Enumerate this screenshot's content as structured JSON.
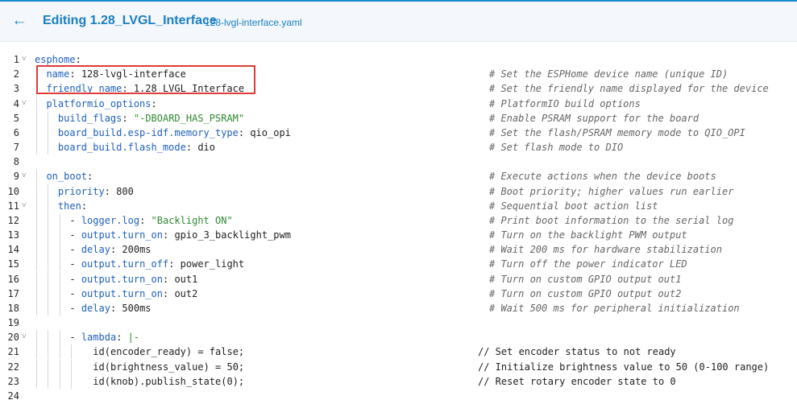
{
  "header": {
    "title": "Editing 1.28_LVGL_Interface",
    "filename": "128-lvgl-interface.yaml"
  },
  "lines": [
    {
      "n": "1",
      "fold": true,
      "indent": 0,
      "key": "esphome",
      "sep": ":",
      "val": "",
      "vtype": "",
      "cmt": ""
    },
    {
      "n": "2",
      "fold": false,
      "indent": 1,
      "key": "name",
      "sep": ":",
      "val": " 128-lvgl-interface",
      "vtype": "",
      "cmt": "# Set the ESPHome device name (unique ID)"
    },
    {
      "n": "3",
      "fold": false,
      "indent": 1,
      "key": "friendly_name",
      "sep": ":",
      "val": " 1.28_LVGL_Interface",
      "vtype": "",
      "cmt": "# Set the friendly name displayed for the device"
    },
    {
      "n": "4",
      "fold": true,
      "indent": 1,
      "key": "platformio_options",
      "sep": ":",
      "val": "",
      "vtype": "",
      "cmt": "# PlatformIO build options"
    },
    {
      "n": "5",
      "fold": false,
      "indent": 2,
      "key": "build_flags",
      "sep": ":",
      "val": " \"-DBOARD_HAS_PSRAM\"",
      "vtype": "s",
      "cmt": "# Enable PSRAM support for the board"
    },
    {
      "n": "6",
      "fold": false,
      "indent": 2,
      "key": "board_build.esp-idf.memory_type",
      "sep": ":",
      "val": " qio_opi",
      "vtype": "",
      "cmt": "# Set the flash/PSRAM memory mode to QIO_OPI"
    },
    {
      "n": "7",
      "fold": false,
      "indent": 2,
      "key": "board_build.flash_mode",
      "sep": ":",
      "val": " dio",
      "vtype": "",
      "cmt": "# Set flash mode to DIO"
    },
    {
      "n": "8",
      "fold": false,
      "indent": 0,
      "key": "",
      "sep": "",
      "val": "",
      "vtype": "",
      "cmt": ""
    },
    {
      "n": "9",
      "fold": true,
      "indent": 1,
      "key": "on_boot",
      "sep": ":",
      "val": "",
      "vtype": "",
      "cmt": "# Execute actions when the device boots"
    },
    {
      "n": "10",
      "fold": false,
      "indent": 2,
      "key": "priority",
      "sep": ":",
      "val": " 800",
      "vtype": "",
      "cmt": "# Boot priority; higher values run earlier"
    },
    {
      "n": "11",
      "fold": true,
      "indent": 2,
      "key": "then",
      "sep": ":",
      "val": "",
      "vtype": "",
      "cmt": "# Sequential boot action list"
    },
    {
      "n": "12",
      "fold": false,
      "indent": 3,
      "key": "- logger.log",
      "sep": ":",
      "val": " \"Backlight ON\"",
      "vtype": "s",
      "cmt": "# Print boot information to the serial log"
    },
    {
      "n": "13",
      "fold": false,
      "indent": 3,
      "key": "- output.turn_on",
      "sep": ":",
      "val": " gpio_3_backlight_pwm",
      "vtype": "",
      "cmt": "# Turn on the backlight PWM output"
    },
    {
      "n": "14",
      "fold": false,
      "indent": 3,
      "key": "- delay",
      "sep": ":",
      "val": " 200ms",
      "vtype": "",
      "cmt": "# Wait 200 ms for hardware stabilization"
    },
    {
      "n": "15",
      "fold": false,
      "indent": 3,
      "key": "- output.turn_off",
      "sep": ":",
      "val": " power_light",
      "vtype": "",
      "cmt": "# Turn off the power indicator LED"
    },
    {
      "n": "16",
      "fold": false,
      "indent": 3,
      "key": "- output.turn_on",
      "sep": ":",
      "val": " out1",
      "vtype": "",
      "cmt": "# Turn on custom GPIO output out1"
    },
    {
      "n": "17",
      "fold": false,
      "indent": 3,
      "key": "- output.turn_on",
      "sep": ":",
      "val": " out2",
      "vtype": "",
      "cmt": "# Turn on custom GPIO output out2"
    },
    {
      "n": "18",
      "fold": false,
      "indent": 3,
      "key": "- delay",
      "sep": ":",
      "val": " 500ms",
      "vtype": "",
      "cmt": "# Wait 500 ms for peripheral initialization"
    },
    {
      "n": "19",
      "fold": false,
      "indent": 0,
      "key": "",
      "sep": "",
      "val": "",
      "vtype": "",
      "cmt": ""
    },
    {
      "n": "20",
      "fold": true,
      "indent": 3,
      "key": "- lambda",
      "sep": ":",
      "val": " |-",
      "vtype": "s",
      "cmt": ""
    },
    {
      "n": "21",
      "fold": false,
      "indent": 5,
      "key": "",
      "sep": "",
      "val": "id(encoder_ready) = false;",
      "vtype": "",
      "cmt": "// Set encoder status to not ready",
      "plain": true
    },
    {
      "n": "22",
      "fold": false,
      "indent": 5,
      "key": "",
      "sep": "",
      "val": "id(brightness_value) = 50;",
      "vtype": "",
      "cmt": "// Initialize brightness value to 50 (0-100 range)",
      "plain": true
    },
    {
      "n": "23",
      "fold": false,
      "indent": 5,
      "key": "",
      "sep": "",
      "val": "id(knob).publish_state(0);",
      "vtype": "",
      "cmt": "// Reset rotary encoder state to 0",
      "plain": true
    },
    {
      "n": "24",
      "fold": false,
      "indent": 0,
      "key": "",
      "sep": "",
      "val": "",
      "vtype": "",
      "cmt": ""
    }
  ]
}
